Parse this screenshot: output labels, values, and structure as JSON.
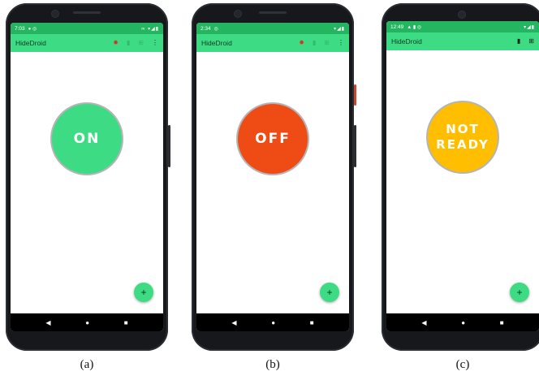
{
  "phones": [
    {
      "status_time": "7:03",
      "status_icons": "● ◎",
      "status_right": "∞ ▾◢▮",
      "app_title": "HideDroid",
      "state_text": "ON",
      "state_color": "#3ddc84",
      "caption": "(a)"
    },
    {
      "status_time": "2:34",
      "status_icons": "◎",
      "status_right": "▾◢▮",
      "app_title": "HideDroid",
      "state_text": "OFF",
      "state_color": "#ef4b14",
      "caption": "(b)"
    },
    {
      "status_time": "12:49",
      "status_icons": "▲ ▮ ◎",
      "status_right": "▾◢▮",
      "app_title": "HideDroid",
      "state_line1": "NOT",
      "state_line2": "READY",
      "state_color": "#ffbe00",
      "caption": "(c)"
    }
  ],
  "icons": {
    "bug": "bug-icon",
    "delete": "trash-icon",
    "export": "export-icon",
    "overflow": "more-vert-icon",
    "fab": "plus-icon",
    "nav_back": "back-triangle-icon",
    "nav_home": "home-circle-icon",
    "nav_recent": "recents-square-icon"
  },
  "glyphs": {
    "fab": "+",
    "back": "◀",
    "home": "●",
    "recent": "■",
    "bug": "✹",
    "trash": "▮",
    "export": "⊞",
    "more": "⋮"
  }
}
